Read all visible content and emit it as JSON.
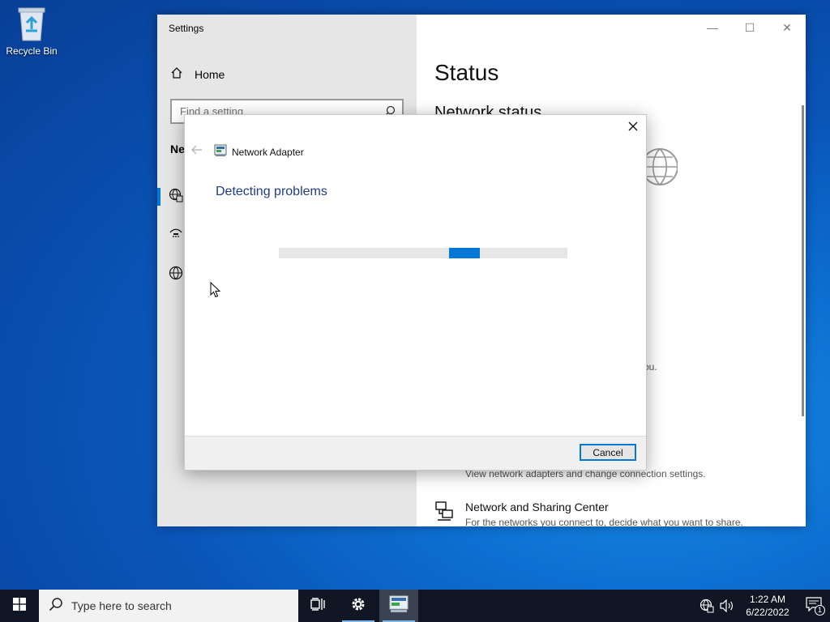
{
  "desktop": {
    "recycle_bin_label": "Recycle Bin"
  },
  "settings": {
    "window_title": "Settings",
    "home_label": "Home",
    "search_placeholder": "Find a setting",
    "nav_heading_partial": "Ne",
    "caption": {
      "minimize": "—",
      "maximize": "☐",
      "close": "✕"
    },
    "status_title": "Status",
    "network_status_label": "Network status",
    "partial_text": "ou.",
    "links": [
      {
        "title": "",
        "desc": "View network adapters and change connection settings."
      },
      {
        "title": "Network and Sharing Center",
        "desc": "For the networks you connect to, decide what you want to share."
      }
    ]
  },
  "dialog": {
    "title": "Network Adapter",
    "heading": "Detecting problems",
    "cancel_label": "Cancel",
    "progress_indeterminate": true
  },
  "taskbar": {
    "search_placeholder": "Type here to search",
    "time": "1:22 AM",
    "date": "6/22/2022",
    "notification_count": "1"
  },
  "colors": {
    "accent": "#0078d7",
    "dialog_heading": "#1e3c8c",
    "taskbar": "#101624"
  }
}
